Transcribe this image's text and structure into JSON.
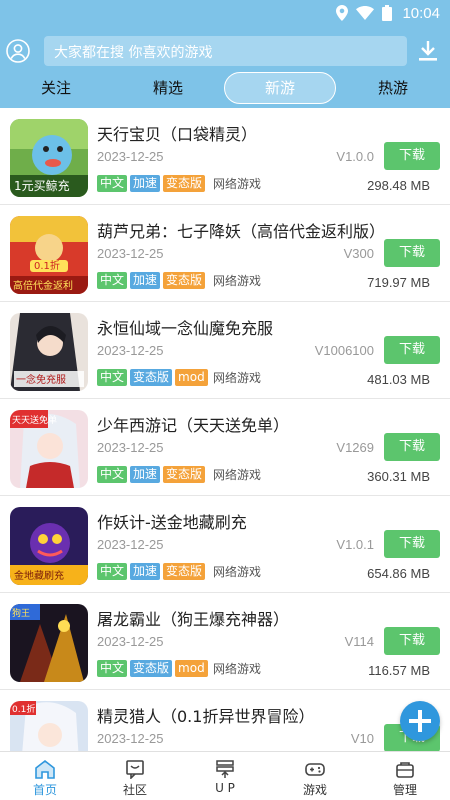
{
  "status_bar": {
    "time": "10:04"
  },
  "search": {
    "placeholder": "大家都在搜 你喜欢的游戏"
  },
  "tabs": [
    {
      "label": "关注",
      "active": false
    },
    {
      "label": "精选",
      "active": false
    },
    {
      "label": "新游",
      "active": true
    },
    {
      "label": "热游",
      "active": false
    }
  ],
  "download_label": "下载",
  "games": [
    {
      "title": "天行宝贝（口袋精灵）",
      "date": "2023-12-25",
      "version": "V1.0.0",
      "tags": [
        "中文",
        "加速",
        "变态版"
      ],
      "type": "网络游戏",
      "size": "298.48 MB"
    },
    {
      "title": "葫芦兄弟：七子降妖（高倍代金返利版）",
      "date": "2023-12-25",
      "version": "V300",
      "tags": [
        "中文",
        "加速",
        "变态版"
      ],
      "type": "网络游戏",
      "size": "719.97 MB"
    },
    {
      "title": "永恒仙域一念仙魔免充服",
      "date": "2023-12-25",
      "version": "V1006100",
      "tags": [
        "中文",
        "变态版",
        "mod"
      ],
      "type": "网络游戏",
      "size": "481.03 MB"
    },
    {
      "title": "少年西游记（天天送免单）",
      "date": "2023-12-25",
      "version": "V1269",
      "tags": [
        "中文",
        "加速",
        "变态版"
      ],
      "type": "网络游戏",
      "size": "360.31 MB"
    },
    {
      "title": "作妖计-送金地藏刷充",
      "date": "2023-12-25",
      "version": "V1.0.1",
      "tags": [
        "中文",
        "加速",
        "变态版"
      ],
      "type": "网络游戏",
      "size": "654.86 MB"
    },
    {
      "title": "屠龙霸业（狗王爆充神器）",
      "date": "2023-12-25",
      "version": "V114",
      "tags": [
        "中文",
        "变态版",
        "mod"
      ],
      "type": "网络游戏",
      "size": "116.57 MB"
    },
    {
      "title": "精灵猎人（0.1折异世界冒险）",
      "date": "2023-12-25",
      "version": "V10",
      "tags": [],
      "type": "",
      "size": ""
    }
  ],
  "thumb_texts": [
    "1元买鲸充",
    "0.1折",
    "高倍代金返利",
    "一念免充服",
    "天天送免单",
    "金地藏刷充",
    "狗王",
    "0.1折"
  ],
  "bottom_nav": [
    {
      "label": "首页",
      "icon": "home-icon",
      "active": true
    },
    {
      "label": "社区",
      "icon": "community-icon",
      "active": false
    },
    {
      "label": "U P",
      "icon": "up-icon",
      "active": false
    },
    {
      "label": "游戏",
      "icon": "gamepad-icon",
      "active": false
    },
    {
      "label": "管理",
      "icon": "manage-icon",
      "active": false
    }
  ],
  "colors": {
    "header": "#7ec3e8",
    "download_button": "#5cc56d",
    "tag_cn": "#5cc56d",
    "tag_speed": "#58a9e0",
    "tag_mod": "#f4a23a",
    "fab": "#2f97dd",
    "nav_active": "#2f97dd"
  }
}
